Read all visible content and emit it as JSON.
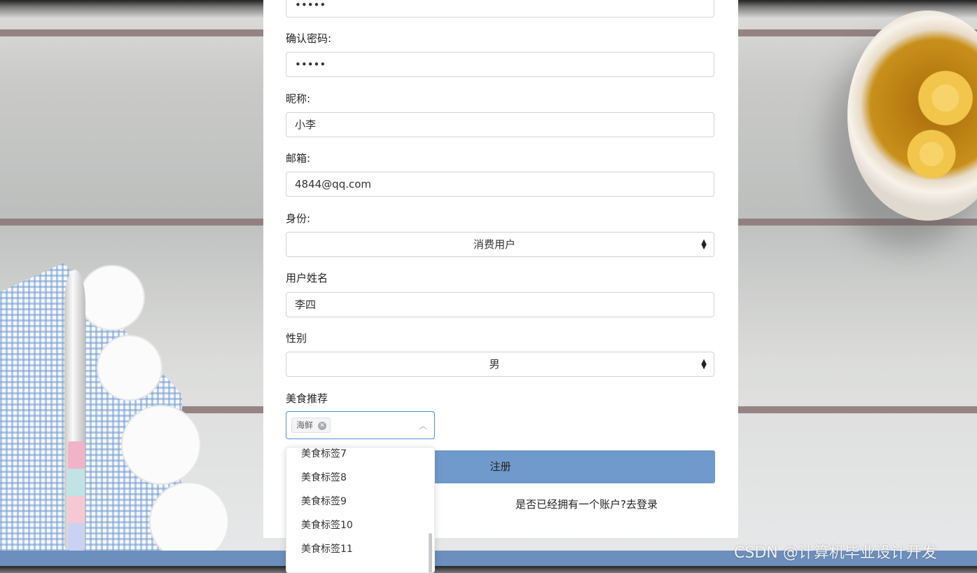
{
  "form": {
    "password_value": "•••••",
    "confirm_password_label": "确认密码:",
    "confirm_password_value": "•••••",
    "nickname_label": "昵称:",
    "nickname_value": "小李",
    "email_label": "邮箱:",
    "email_value": "4844@qq.com",
    "role_label": "身份:",
    "role_value": "消费用户",
    "real_name_label": "用户姓名",
    "real_name_value": "李四",
    "gender_label": "性别",
    "gender_value": "男",
    "food_label": "美食推荐",
    "food_selected_tag": "海鲜",
    "submit_label": "注册",
    "login_link": "是否已经拥有一个账户?去登录"
  },
  "dropdown": {
    "options": [
      "美食标签7",
      "美食标签8",
      "美食标签9",
      "美食标签10",
      "美食标签11"
    ]
  },
  "watermark": "CSDN @计算机毕业设计开发",
  "colors": {
    "submit_bg": "#6f9acb",
    "focus_border": "#5b8ed6",
    "bottom_bar": "#6c8fbd"
  }
}
